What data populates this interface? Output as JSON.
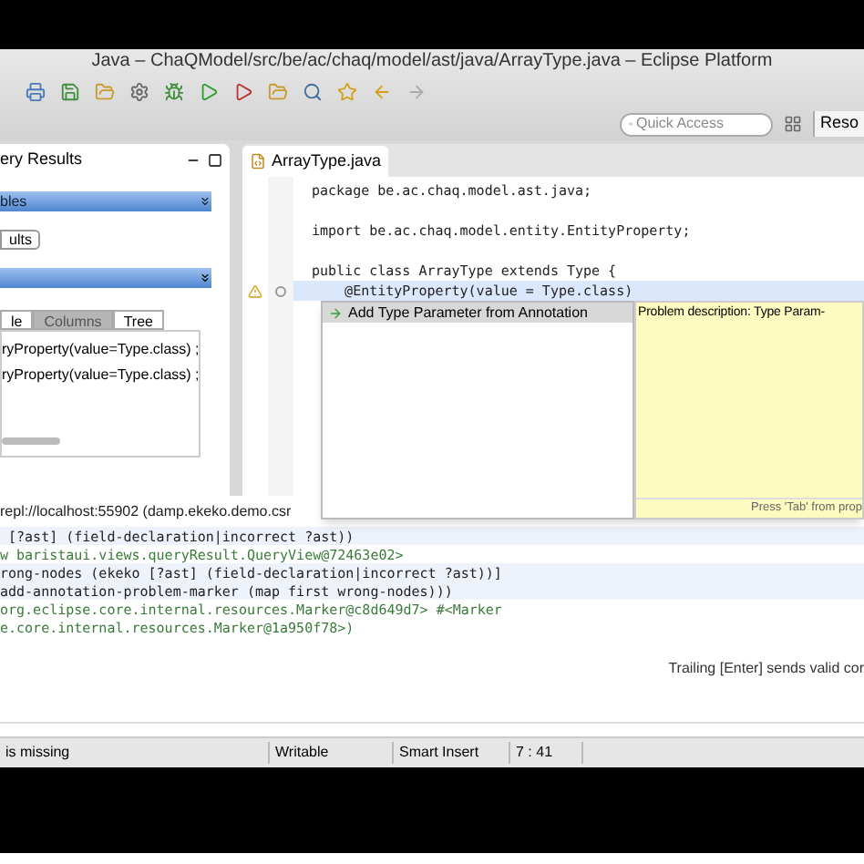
{
  "window": {
    "title": "Java – ChaQModel/src/be/ac/chaq/model/ast/java/ArrayType.java – Eclipse Platform"
  },
  "toolbar": {
    "quick_access": {
      "placeholder": "Quick Access"
    },
    "perspective": "Reso"
  },
  "query_panel": {
    "tab": "ery Results",
    "section_1": "bles",
    "button": "ults",
    "view_tabs": [
      {
        "label": "le",
        "selected": false
      },
      {
        "label": "Columns",
        "selected": true
      },
      {
        "label": "Tree",
        "selected": false
      }
    ],
    "rows": [
      "ryProperty(value=Type.class) ;",
      "ryProperty(value=Type.class) ;"
    ]
  },
  "editor": {
    "tab": "ArrayType.java",
    "lines": [
      {
        "text": "package be.ac.chaq.model.ast.java;",
        "highlighted": false,
        "marker": false,
        "fold": false
      },
      {
        "highlighted": false,
        "marker": false,
        "fold": false
      },
      {
        "text": "import be.ac.chaq.model.entity.EntityProperty;",
        "highlighted": false,
        "marker": false,
        "fold": false
      },
      {
        "highlighted": false,
        "marker": false,
        "fold": false
      },
      {
        "text": "public class ArrayType extends Type {",
        "highlighted": false,
        "marker": false,
        "fold": false
      },
      {
        "text": "    @EntityProperty(value = Type.class)",
        "highlighted": true,
        "marker": true,
        "fold": true
      }
    ]
  },
  "quick_fix": {
    "items": [
      {
        "label": "Add Type Parameter from Annotation",
        "selected": true
      }
    ],
    "description": "Problem description: Type Param-",
    "hint": "Press 'Tab' from prop"
  },
  "repl": {
    "title": "repl://localhost:55902 (damp.ekeko.demo.csr",
    "lines": [
      {
        "text": " [?ast] (field-declaration|incorrect ?ast))",
        "kind": "input"
      },
      {
        "text": "w baristaui.views.queryResult.QueryView@72463e02>",
        "kind": "output"
      },
      {
        "text": "rong-nodes (ekeko [?ast] (field-declaration|incorrect ?ast))]",
        "kind": "input"
      },
      {
        "text": "add-annotation-problem-marker (map first wrong-nodes)))",
        "kind": "input"
      },
      {
        "text": "org.eclipse.core.internal.resources.Marker@c8d649d7> #<Marker",
        "kind": "output"
      },
      {
        "text": "e.core.internal.resources.Marker@1a950f78>)",
        "kind": "output"
      }
    ],
    "hint": "Trailing [Enter] sends valid cor"
  },
  "status_bar": [
    "is missing",
    "Writable",
    "Smart Insert",
    "7 : 41"
  ]
}
